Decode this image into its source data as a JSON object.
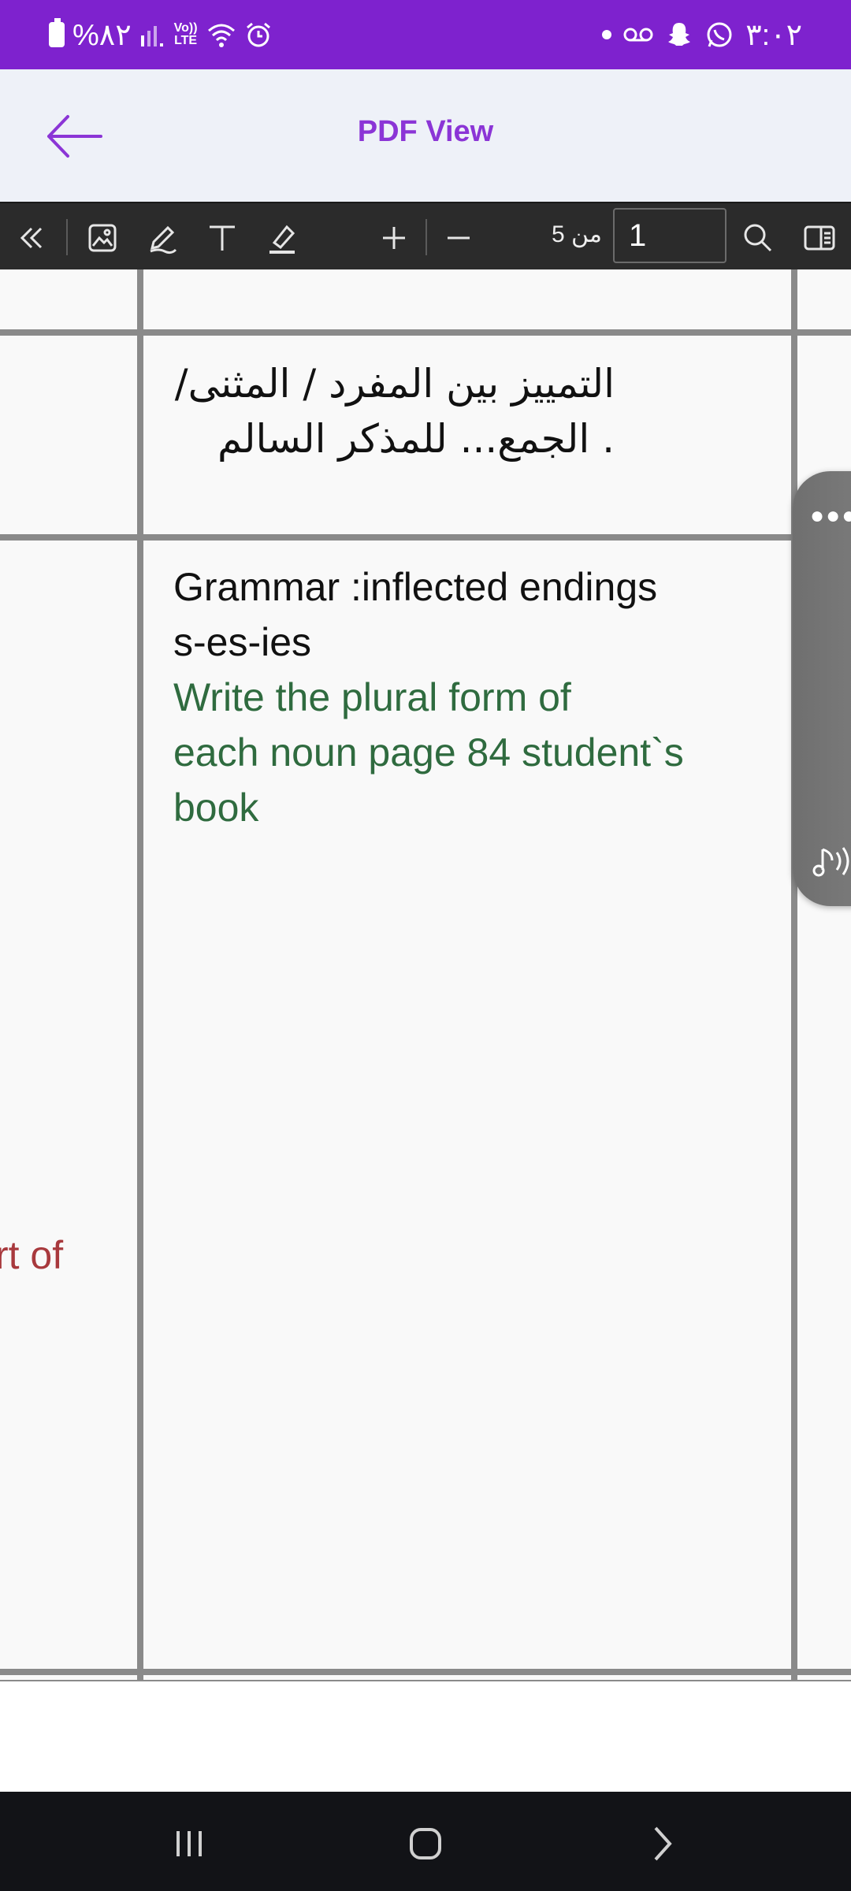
{
  "status_bar": {
    "time": "٣:٠٢",
    "battery": "%٨٢",
    "network": "Vo)) LTE",
    "colors": {
      "background": "#7e22ce"
    }
  },
  "header": {
    "title": "PDF View",
    "back_icon": "arrow-left-icon",
    "title_color": "#8b35d6"
  },
  "toolbar": {
    "icons": [
      "collapse-left-icon",
      "image-icon",
      "pen-icon",
      "text-icon",
      "highlighter-icon",
      "zoom-in-icon",
      "zoom-out-icon",
      "search-icon",
      "panel-toggle-icon"
    ],
    "page_total": "من 5",
    "page_current": "1"
  },
  "document": {
    "arabic_line1": "التمييز بين المفرد / المثنى/",
    "arabic_line2": ". الجمع... للمذكر السالم",
    "grammar_line1": "Grammar :inflected endings",
    "grammar_line2": "s-es-ies",
    "task_line1": "Write  the plural form  of",
    "task_line2": "each noun page 84 student`s",
    "task_line3": "book",
    "left_partial": "rt of",
    "colors": {
      "task_green": "#2f6b3f",
      "partial_red": "#a8393d"
    }
  },
  "floating_handle": {
    "menu_icon": "more-dots-icon",
    "audio_icon": "audio-speaker-icon"
  },
  "nav_bar": {
    "icons": [
      "recent-apps-icon",
      "home-icon",
      "back-chevron-icon"
    ]
  }
}
